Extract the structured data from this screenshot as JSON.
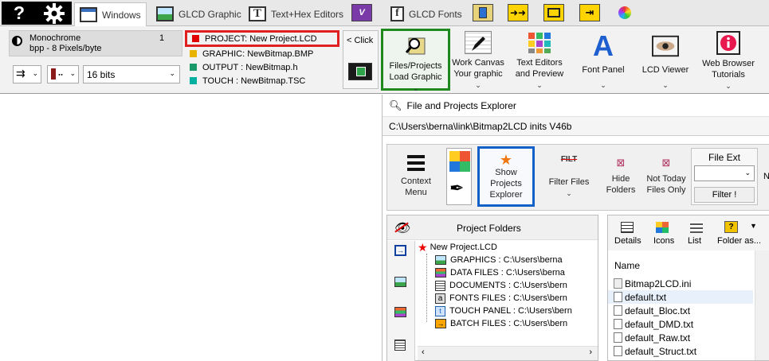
{
  "tabs": {
    "help_label": "?",
    "windows": "Windows",
    "glcd_graphic": "GLCD Graphic",
    "text_hex": "Text+Hex Editors",
    "v_label": "V",
    "glcd_fonts": "GLCD Fonts",
    "f_label": "f"
  },
  "ribbon": {
    "monochrome": "Monochrome",
    "bpp_value": "1",
    "bpp_label": "bpp - 8 Pixels/byte",
    "bits_value": "16 bits",
    "click_label": "< Click",
    "project": "PROJECT: New Project.LCD",
    "graphic": "GRAPHIC: NewBitmap.BMP",
    "output": "OUTPUT : NewBitmap.h",
    "touch": "TOUCH  : NewBitmap.TSC",
    "colors": {
      "project": "#e00000",
      "graphic": "#e8b400",
      "output": "#1a9a6a",
      "touch": "#00b0a0",
      "red_frame": "#e02020",
      "green_frame": "#1e8a1e"
    },
    "files_projects": [
      "Files/Projects",
      "Load Graphic"
    ],
    "work_canvas": [
      "Work Canvas",
      "Your graphic"
    ],
    "text_editors": [
      "Text Editors",
      "and Preview"
    ],
    "font_panel": "Font Panel",
    "lcd_viewer": "LCD Viewer",
    "web_browser": [
      "Web Browser",
      "Tutorials"
    ]
  },
  "explorer": {
    "title": "File and Projects Explorer",
    "path": "C:\\Users\\berna\\link\\Bitmap2LCD inits V46b",
    "context_menu": [
      "Context",
      "Menu"
    ],
    "show_projects": [
      "Show",
      "Projects",
      "Explorer"
    ],
    "filter_files": "Filter Files",
    "filt_glyph": "FILT",
    "hide_folders": [
      "Hide",
      "Folders"
    ],
    "not_today": [
      "Not Today",
      "Files Only"
    ],
    "file_ext": "File Ext",
    "filter_btn": "Filter !",
    "trailing": "N",
    "blue_frame": "#1060c8",
    "project_folders": "Project Folders",
    "project_name": "New Project.LCD",
    "tree": [
      "GRAPHICS    : C:\\Users\\berna",
      "DATA FILES   : C:\\Users\\berna",
      "DOCUMENTS  : C:\\Users\\bern",
      "FONTS FILES   : C:\\Users\\bern",
      "TOUCH PANEL : C:\\Users\\bern",
      "BATCH FILES : C:\\Users\\bern"
    ],
    "view_tabs": [
      "Details",
      "Icons",
      "List",
      "Folder as..."
    ],
    "name_header": "Name",
    "files": [
      "Bitmap2LCD.ini",
      "default.txt",
      "default_Bloc.txt",
      "default_DMD.txt",
      "default_Raw.txt",
      "default_Struct.txt"
    ]
  }
}
